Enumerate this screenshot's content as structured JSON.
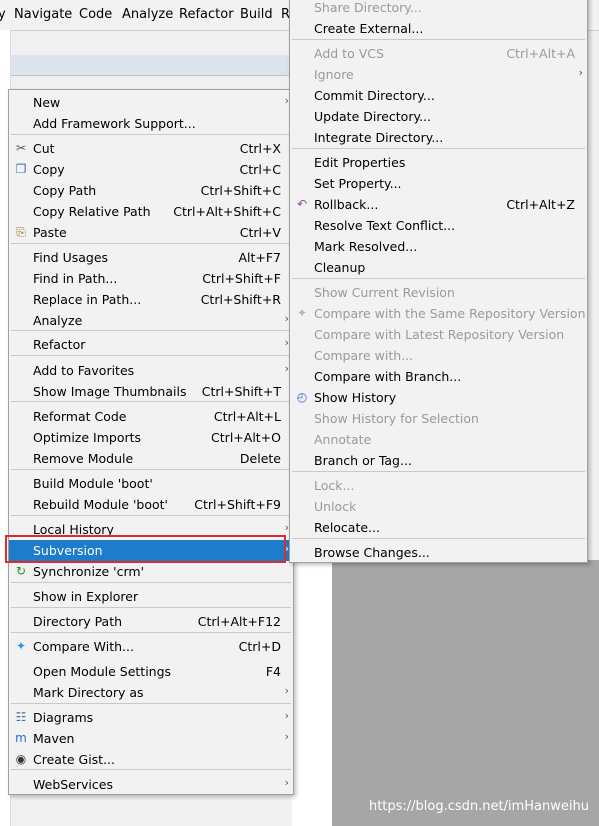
{
  "menubar": [
    "Navigate",
    "Code",
    "Analyze",
    "Refactor",
    "Build",
    "R"
  ],
  "context_menu": {
    "items": [
      {
        "label": "New",
        "shortcut": "",
        "arrow": true,
        "icon": ""
      },
      {
        "label": "Add Framework Support...",
        "shortcut": "",
        "arrow": false,
        "icon": ""
      },
      {
        "label": "Cut",
        "shortcut": "Ctrl+X",
        "arrow": false,
        "icon": "scissors-icon"
      },
      {
        "label": "Copy",
        "shortcut": "Ctrl+C",
        "arrow": false,
        "icon": "copy-icon"
      },
      {
        "label": "Copy Path",
        "shortcut": "Ctrl+Shift+C",
        "arrow": false,
        "icon": ""
      },
      {
        "label": "Copy Relative Path",
        "shortcut": "Ctrl+Alt+Shift+C",
        "arrow": false,
        "icon": ""
      },
      {
        "label": "Paste",
        "shortcut": "Ctrl+V",
        "arrow": false,
        "icon": "paste-icon"
      },
      {
        "label": "Find Usages",
        "shortcut": "Alt+F7",
        "arrow": false,
        "icon": ""
      },
      {
        "label": "Find in Path...",
        "shortcut": "Ctrl+Shift+F",
        "arrow": false,
        "icon": ""
      },
      {
        "label": "Replace in Path...",
        "shortcut": "Ctrl+Shift+R",
        "arrow": false,
        "icon": ""
      },
      {
        "label": "Analyze",
        "shortcut": "",
        "arrow": true,
        "icon": ""
      },
      {
        "label": "Refactor",
        "shortcut": "",
        "arrow": true,
        "icon": ""
      },
      {
        "label": "Add to Favorites",
        "shortcut": "",
        "arrow": true,
        "icon": ""
      },
      {
        "label": "Show Image Thumbnails",
        "shortcut": "Ctrl+Shift+T",
        "arrow": false,
        "icon": ""
      },
      {
        "label": "Reformat Code",
        "shortcut": "Ctrl+Alt+L",
        "arrow": false,
        "icon": ""
      },
      {
        "label": "Optimize Imports",
        "shortcut": "Ctrl+Alt+O",
        "arrow": false,
        "icon": ""
      },
      {
        "label": "Remove Module",
        "shortcut": "Delete",
        "arrow": false,
        "icon": ""
      },
      {
        "label": "Build Module 'boot'",
        "shortcut": "",
        "arrow": false,
        "icon": ""
      },
      {
        "label": "Rebuild Module 'boot'",
        "shortcut": "Ctrl+Shift+F9",
        "arrow": false,
        "icon": ""
      },
      {
        "label": "Local History",
        "shortcut": "",
        "arrow": true,
        "icon": ""
      },
      {
        "label": "Subversion",
        "shortcut": "",
        "arrow": true,
        "icon": "",
        "selected": true
      },
      {
        "label": "Synchronize 'crm'",
        "shortcut": "",
        "arrow": false,
        "icon": "sync-icon"
      },
      {
        "label": "Show in Explorer",
        "shortcut": "",
        "arrow": false,
        "icon": ""
      },
      {
        "label": "Directory Path",
        "shortcut": "Ctrl+Alt+F12",
        "arrow": false,
        "icon": ""
      },
      {
        "label": "Compare With...",
        "shortcut": "Ctrl+D",
        "arrow": false,
        "icon": "compare-icon"
      },
      {
        "label": "Open Module Settings",
        "shortcut": "F4",
        "arrow": false,
        "icon": ""
      },
      {
        "label": "Mark Directory as",
        "shortcut": "",
        "arrow": true,
        "icon": ""
      },
      {
        "label": "Diagrams",
        "shortcut": "",
        "arrow": true,
        "icon": "diagram-icon"
      },
      {
        "label": "Maven",
        "shortcut": "",
        "arrow": true,
        "icon": "maven-icon"
      },
      {
        "label": "Create Gist...",
        "shortcut": "",
        "arrow": false,
        "icon": "github-icon"
      },
      {
        "label": "WebServices",
        "shortcut": "",
        "arrow": true,
        "icon": ""
      }
    ]
  },
  "submenu": {
    "items": [
      {
        "label": "Share Directory...",
        "shortcut": "",
        "disabled": true,
        "icon": ""
      },
      {
        "label": "Create External...",
        "shortcut": "",
        "disabled": false,
        "icon": ""
      },
      {
        "label": "Add to VCS",
        "shortcut": "Ctrl+Alt+A",
        "disabled": true,
        "icon": ""
      },
      {
        "label": "Ignore",
        "shortcut": "",
        "disabled": true,
        "arrow": true,
        "icon": ""
      },
      {
        "label": "Commit Directory...",
        "shortcut": "",
        "disabled": false,
        "icon": ""
      },
      {
        "label": "Update Directory...",
        "shortcut": "",
        "disabled": false,
        "icon": ""
      },
      {
        "label": "Integrate Directory...",
        "shortcut": "",
        "disabled": false,
        "icon": ""
      },
      {
        "label": "Edit Properties",
        "shortcut": "",
        "disabled": false,
        "icon": ""
      },
      {
        "label": "Set Property...",
        "shortcut": "",
        "disabled": false,
        "icon": ""
      },
      {
        "label": "Rollback...",
        "shortcut": "Ctrl+Alt+Z",
        "disabled": false,
        "icon": "rollback-icon"
      },
      {
        "label": "Resolve Text Conflict...",
        "shortcut": "",
        "disabled": false,
        "icon": ""
      },
      {
        "label": "Mark Resolved...",
        "shortcut": "",
        "disabled": false,
        "icon": ""
      },
      {
        "label": "Cleanup",
        "shortcut": "",
        "disabled": false,
        "icon": ""
      },
      {
        "label": "Show Current Revision",
        "shortcut": "",
        "disabled": true,
        "icon": ""
      },
      {
        "label": "Compare with the Same Repository Version",
        "shortcut": "",
        "disabled": true,
        "icon": "compare-icon"
      },
      {
        "label": "Compare with Latest Repository Version",
        "shortcut": "",
        "disabled": true,
        "icon": ""
      },
      {
        "label": "Compare with...",
        "shortcut": "",
        "disabled": true,
        "icon": ""
      },
      {
        "label": "Compare with Branch...",
        "shortcut": "",
        "disabled": false,
        "icon": ""
      },
      {
        "label": "Show History",
        "shortcut": "",
        "disabled": false,
        "icon": "history-icon"
      },
      {
        "label": "Show History for Selection",
        "shortcut": "",
        "disabled": true,
        "icon": ""
      },
      {
        "label": "Annotate",
        "shortcut": "",
        "disabled": true,
        "icon": ""
      },
      {
        "label": "Branch or Tag...",
        "shortcut": "",
        "disabled": false,
        "icon": ""
      },
      {
        "label": "Lock...",
        "shortcut": "",
        "disabled": true,
        "icon": ""
      },
      {
        "label": "Unlock",
        "shortcut": "",
        "disabled": true,
        "icon": ""
      },
      {
        "label": "Relocate...",
        "shortcut": "",
        "disabled": false,
        "icon": ""
      },
      {
        "label": "Browse Changes...",
        "shortcut": "",
        "disabled": false,
        "icon": ""
      }
    ]
  },
  "watermark": "https://blog.csdn.net/imHanweihu"
}
